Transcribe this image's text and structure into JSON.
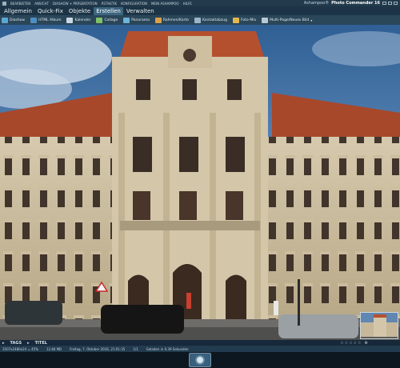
{
  "menubar": {
    "items": [
      "BEARBEITEN",
      "ANSICHT",
      "DIASHOW + PRÄSENTATION",
      "ÄSTHETIK",
      "KONFIGURATION",
      "MEIN ASHAMPOO",
      "HILFE"
    ],
    "app_vendor": "Ashampoo®",
    "app_name": "Photo Commander 16"
  },
  "tabs": [
    {
      "label": "Allgemein",
      "active": false
    },
    {
      "label": "Quick-Fix",
      "active": false
    },
    {
      "label": "Objekte",
      "active": false
    },
    {
      "label": "Erstellen",
      "active": true
    },
    {
      "label": "Verwalten",
      "active": false
    }
  ],
  "toolbar": [
    {
      "label": "Diashow",
      "icon": "slideshow-icon",
      "color": "#5aa7d6"
    },
    {
      "label": "HTML Album",
      "icon": "html-album-icon",
      "color": "#4d8fc2"
    },
    {
      "label": "Kalender",
      "icon": "calendar-icon",
      "color": "#c9d8e4"
    },
    {
      "label": "Collage",
      "icon": "collage-icon",
      "color": "#7fc06a"
    },
    {
      "label": "Panorama",
      "icon": "panorama-icon",
      "color": "#6cb4d8"
    },
    {
      "label": "Rahmen/Karte",
      "icon": "frame-icon",
      "color": "#d9a04a"
    },
    {
      "label": "Kontaktabzug",
      "icon": "contact-sheet-icon",
      "color": "#9db5c8"
    },
    {
      "label": "Foto-Mix",
      "icon": "photo-mix-icon",
      "color": "#e0b84f"
    },
    {
      "label": "Multi-Page/Neues Bild",
      "icon": "multi-page-icon",
      "color": "#b8c8d6",
      "dropdown": true
    }
  ],
  "panel": {
    "tags_label": "TAGS",
    "title_label": "TITEL"
  },
  "status": {
    "dimensions": "3507x2480x24 = 45%",
    "file_size": "12.84 MB",
    "date": "Freitag, 7. Oktober 2016, 21:01:35",
    "page": "1/1",
    "load_time": "Geladen in 0.39 Sekunden"
  },
  "colors": {
    "accent": "#3d6580",
    "sky": "#4d79a8",
    "roof": "#b5502f",
    "stone": "#c9bba0"
  }
}
